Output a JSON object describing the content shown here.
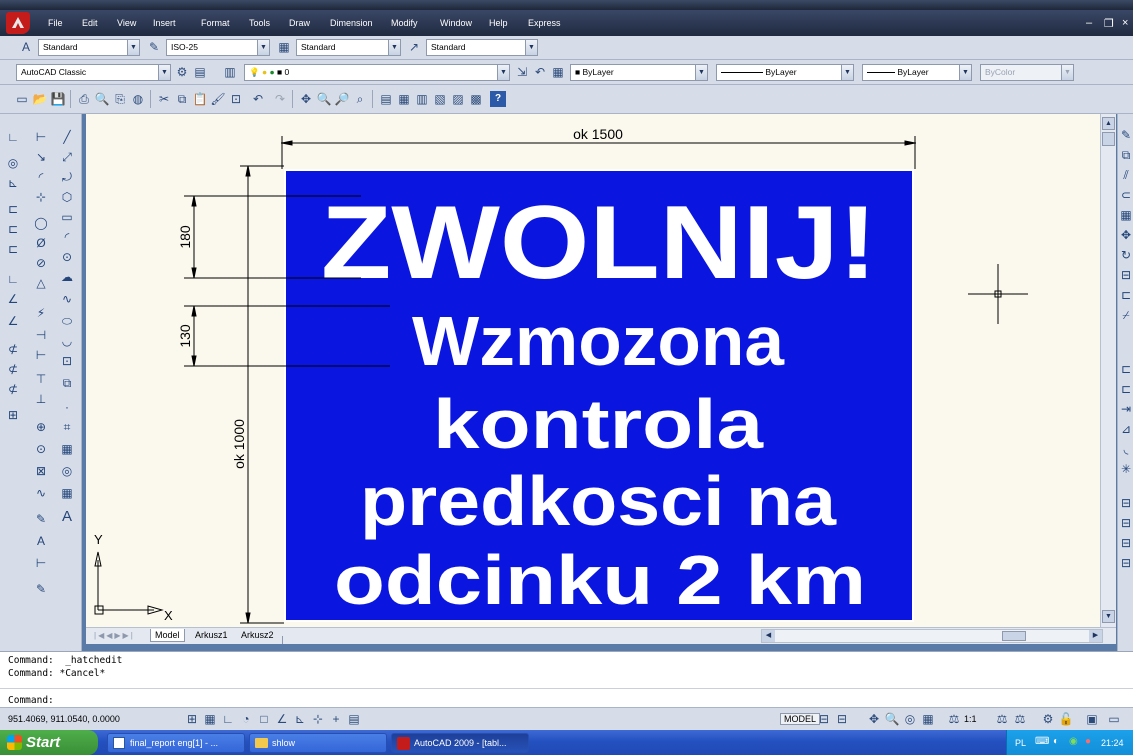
{
  "menu": {
    "items": [
      "File",
      "Edit",
      "View",
      "Insert",
      "Format",
      "Tools",
      "Draw",
      "Dimension",
      "Modify",
      "Window",
      "Help",
      "Express"
    ]
  },
  "styles_toolbar": {
    "text_style": "Standard",
    "dim_style": "ISO-25",
    "table_style": "Standard",
    "multileader_style": "Standard"
  },
  "layers_toolbar": {
    "workspace": "AutoCAD Classic",
    "layer": "0",
    "color": "ByLayer",
    "linetype": "ByLayer",
    "lineweight": "ByLayer",
    "plotstyle": "ByColor"
  },
  "drawing": {
    "sign_color": "#0a16e0",
    "sign_text_color": "#ffffff",
    "dim_color": "#000000",
    "sign_lines": [
      "ZWOLNIJ!",
      "Wzmozona",
      "kontrola",
      "predkosci na",
      "odcinku 2 km"
    ],
    "dim_width": "ok 1500",
    "dim_height": "ok 1000",
    "dim_line1": "180",
    "dim_line2": "130",
    "ucs_x": "X",
    "ucs_y": "Y"
  },
  "tabs": [
    "Model",
    "Arkusz1",
    "Arkusz2"
  ],
  "command": {
    "history": [
      "Command:  _hatchedit",
      "Command: *Cancel*"
    ],
    "prompt": "Command:"
  },
  "status": {
    "coordinates": "951.4069, 911.0540, 0.0000",
    "model_label": "MODEL",
    "anno_scale": "1:1"
  },
  "taskbar": {
    "start_label": "Start",
    "tasks": [
      "final_report eng[1] - ...",
      "shlow",
      "AutoCAD 2009 - [tabl..."
    ],
    "lang": "PL",
    "clock": "21:24"
  }
}
